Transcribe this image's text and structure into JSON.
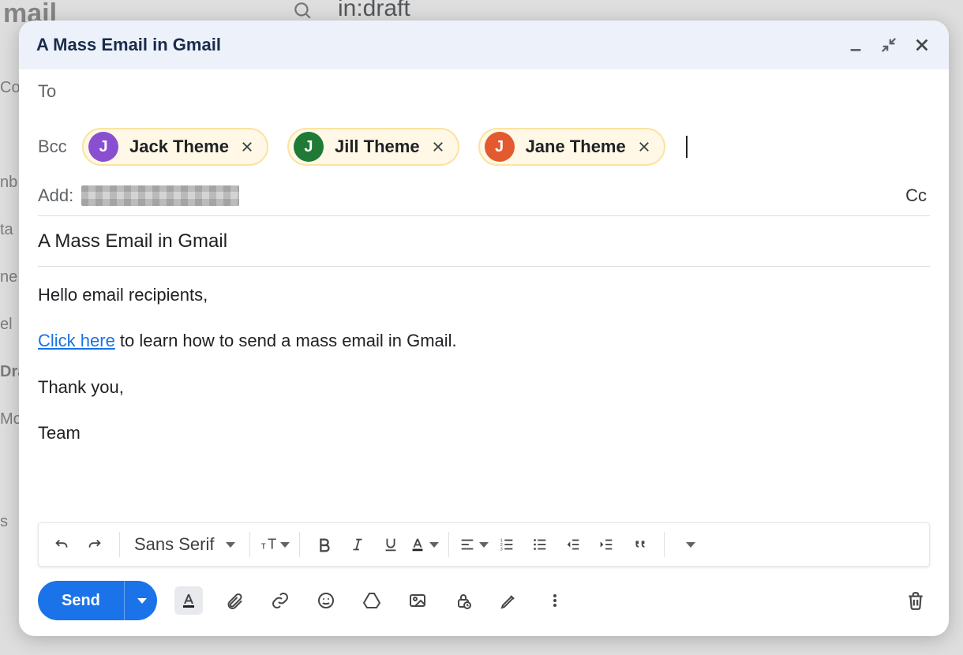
{
  "background": {
    "logo_fragment": "mail",
    "search_value": "in:draft",
    "left_labels": [
      "Co",
      "nb",
      "ta",
      "ne",
      "el",
      "Dra",
      "Mo",
      "s"
    ]
  },
  "compose": {
    "title": "A Mass Email in Gmail",
    "to_label": "To",
    "bcc_label": "Bcc",
    "add_label": "Add:",
    "cc_toggle": "Cc",
    "subject": "A Mass Email in Gmail",
    "recipients": [
      {
        "initial": "J",
        "name": "Jack Theme",
        "avatar_color": "#8a4fd0"
      },
      {
        "initial": "J",
        "name": "Jill Theme",
        "avatar_color": "#1e7a34"
      },
      {
        "initial": "J",
        "name": "Jane Theme",
        "avatar_color": "#e25a2d"
      }
    ],
    "body": {
      "greeting": "Hello email recipients,",
      "link_text": "Click here",
      "after_link": " to learn how to send a mass email in Gmail.",
      "thanks": "Thank you,",
      "signature": "Team"
    },
    "format": {
      "font": "Sans Serif"
    },
    "actions": {
      "send_label": "Send"
    }
  }
}
